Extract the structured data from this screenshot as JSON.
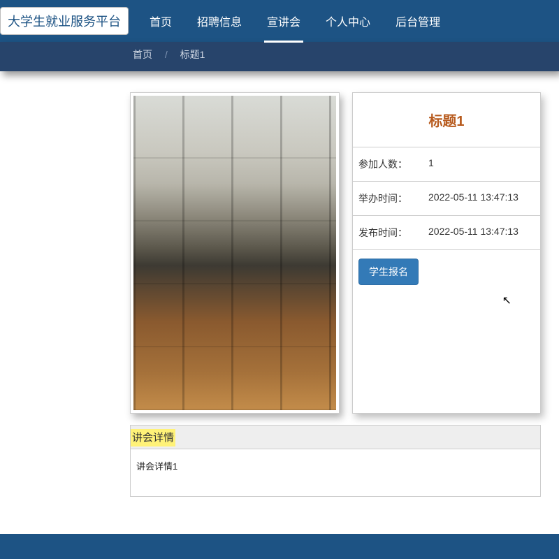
{
  "brand": "大学生就业服务平台",
  "nav": {
    "items": [
      {
        "label": "首页",
        "active": false
      },
      {
        "label": "招聘信息",
        "active": false
      },
      {
        "label": "宣讲会",
        "active": true
      },
      {
        "label": "个人中心",
        "active": false
      },
      {
        "label": "后台管理",
        "active": false
      }
    ]
  },
  "breadcrumb": {
    "home": "首页",
    "sep": "/",
    "current": "标题1"
  },
  "info": {
    "title": "标题1",
    "rows": [
      {
        "label": "参加人数：",
        "value": "1"
      },
      {
        "label": "举办时间：",
        "value": "2022-05-11 13:47:13"
      },
      {
        "label": "发布时间：",
        "value": "2022-05-11 13:47:13"
      }
    ],
    "register_btn": "学生报名"
  },
  "details": {
    "header": "讲会详情",
    "body": "讲会详情1"
  }
}
